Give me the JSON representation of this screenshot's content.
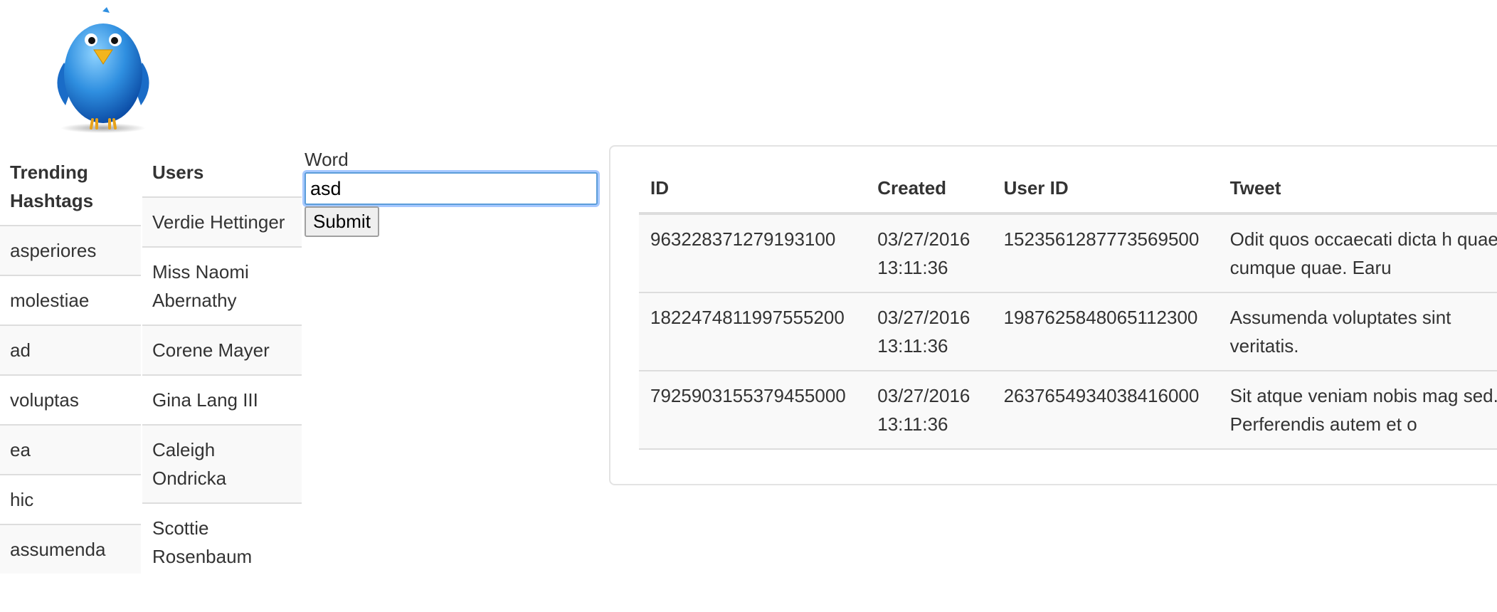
{
  "hashtags": {
    "title": "Trending Hashtags",
    "items": [
      "asperiores",
      "molestiae",
      "ad",
      "voluptas",
      "ea",
      "hic",
      "assumenda"
    ]
  },
  "users": {
    "title": "Users",
    "items": [
      "Verdie Hettinger",
      "Miss Naomi Abernathy",
      "Corene Mayer",
      "Gina Lang III",
      "Caleigh Ondricka",
      "Scottie Rosenbaum"
    ]
  },
  "form": {
    "label": "Word",
    "value": "asd",
    "submit_label": "Submit"
  },
  "table": {
    "headers": [
      "ID",
      "Created",
      "User ID",
      "Tweet"
    ],
    "rows": [
      {
        "id": "963228371279193100",
        "created": "03/27/2016 13:11:36",
        "user_id": "1523561287773569500",
        "tweet": "Odit quos occaecati dicta h quaerat cumque quae. Earu"
      },
      {
        "id": "1822474811997555200",
        "created": "03/27/2016 13:11:36",
        "user_id": "1987625848065112300",
        "tweet": "Assumenda voluptates sint veritatis."
      },
      {
        "id": "7925903155379455000",
        "created": "03/27/2016 13:11:36",
        "user_id": "2637654934038416000",
        "tweet": "Sit atque veniam nobis mag sed. Perferendis autem et o"
      }
    ]
  },
  "colors": {
    "accent": "#5b9dd9",
    "stripe": "#f9f9f9",
    "border": "#dddddd"
  },
  "icons": {
    "logo": "twitter-bird-icon"
  }
}
